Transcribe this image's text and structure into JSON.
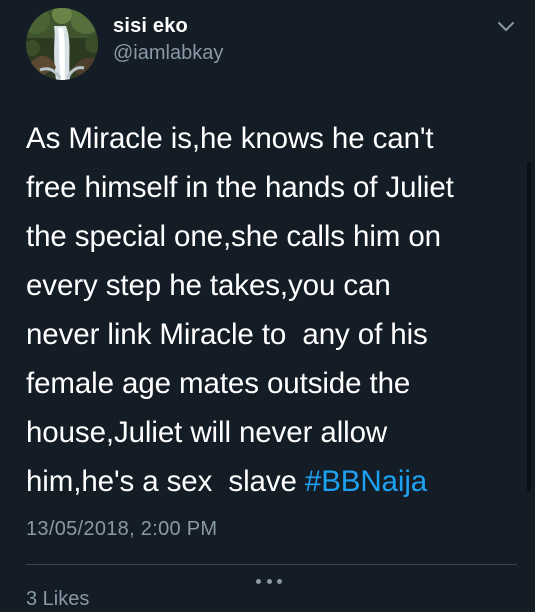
{
  "author": {
    "display_name": "sisi eko",
    "handle": "@iamlabkay",
    "avatar_icon": "waterfall-avatar-icon"
  },
  "tweet": {
    "lines": [
      "As Miracle is,he knows he can't",
      "free himself in the hands of Juliet",
      "the special one,she calls him on",
      "every step he takes,you can",
      "never link Miracle to  any of his",
      "female age mates outside the",
      "house,Juliet will never allow",
      "him,he's a sex  slave "
    ],
    "hashtag": "#BBNaija",
    "timestamp": "13/05/2018, 2:00 PM"
  },
  "footer": {
    "likes_peek": "3 Likes"
  },
  "colors": {
    "background": "#141d26",
    "text": "#ffffff",
    "secondary": "#8899a6",
    "link": "#1da1f2",
    "divider": "#38444d"
  }
}
